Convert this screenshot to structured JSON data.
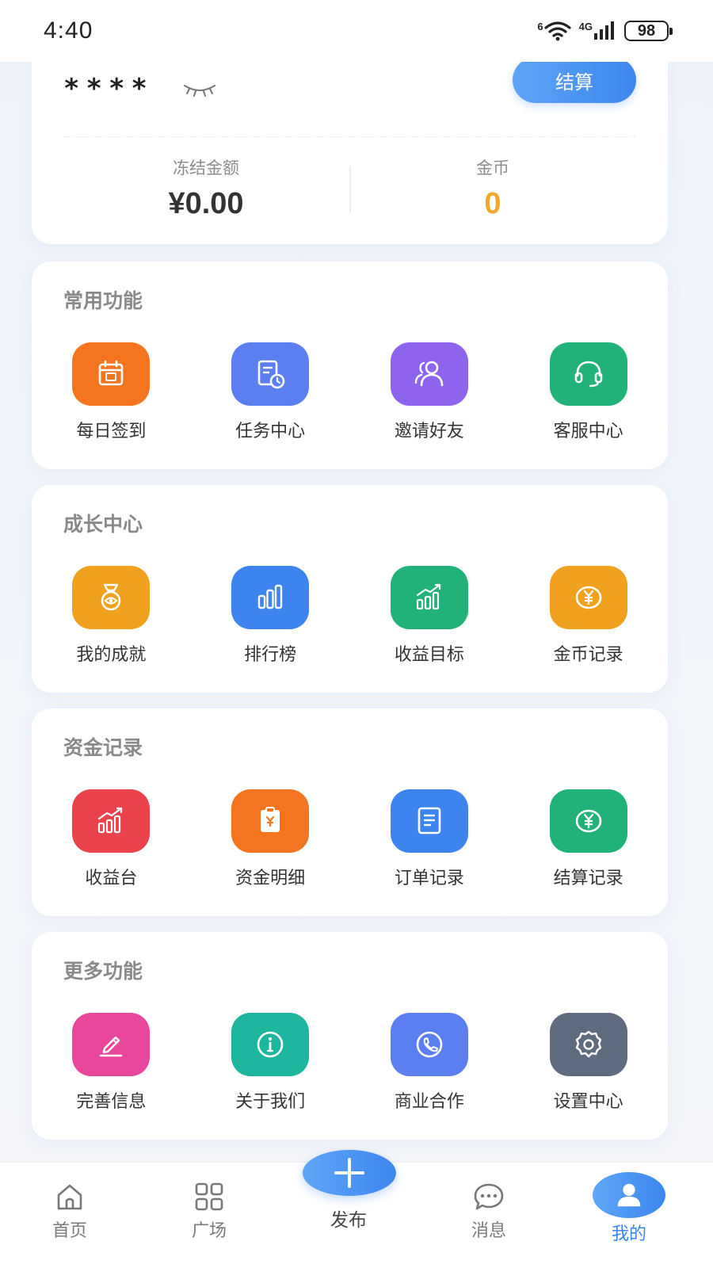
{
  "status_bar": {
    "time": "4:40",
    "wifi_badge": "6",
    "signal_badge": "4G",
    "battery": "98"
  },
  "balance": {
    "masked": "****",
    "settle_button": "结算",
    "frozen_label": "冻结金额",
    "frozen_value": "¥0.00",
    "coins_label": "金币",
    "coins_value": "0"
  },
  "sections": [
    {
      "title": "常用功能",
      "items": [
        {
          "label": "每日签到",
          "icon": "calendar-icon",
          "color": "#f4741f"
        },
        {
          "label": "任务中心",
          "icon": "task-clock-icon",
          "color": "#5b7ff0"
        },
        {
          "label": "邀请好友",
          "icon": "friends-icon",
          "color": "#8e64ee"
        },
        {
          "label": "客服中心",
          "icon": "headset-icon",
          "color": "#21b27a"
        }
      ]
    },
    {
      "title": "成长中心",
      "items": [
        {
          "label": "我的成就",
          "icon": "medal-icon",
          "color": "#f0a11d"
        },
        {
          "label": "排行榜",
          "icon": "bar-chart-icon",
          "color": "#3d84ee"
        },
        {
          "label": "收益目标",
          "icon": "growth-chart-icon",
          "color": "#21b27a"
        },
        {
          "label": "金币记录",
          "icon": "coin-icon",
          "color": "#f0a11d"
        }
      ]
    },
    {
      "title": "资金记录",
      "items": [
        {
          "label": "收益台",
          "icon": "growth-chart-icon",
          "color": "#e9424a"
        },
        {
          "label": "资金明细",
          "icon": "clipboard-yen-icon",
          "color": "#f4741f"
        },
        {
          "label": "订单记录",
          "icon": "document-icon",
          "color": "#3d84ee"
        },
        {
          "label": "结算记录",
          "icon": "coin-icon",
          "color": "#21b27a"
        }
      ]
    },
    {
      "title": "更多功能",
      "items": [
        {
          "label": "完善信息",
          "icon": "pencil-icon",
          "color": "#e9479b"
        },
        {
          "label": "关于我们",
          "icon": "info-icon",
          "color": "#1fb6a0"
        },
        {
          "label": "商业合作",
          "icon": "phone-icon",
          "color": "#5b7ff0"
        },
        {
          "label": "设置中心",
          "icon": "gear-icon",
          "color": "#5f6b7e"
        }
      ]
    }
  ],
  "tabbar": {
    "home": "首页",
    "square": "广场",
    "publish": "发布",
    "messages": "消息",
    "me": "我的",
    "active_color": "#3a84ee"
  }
}
